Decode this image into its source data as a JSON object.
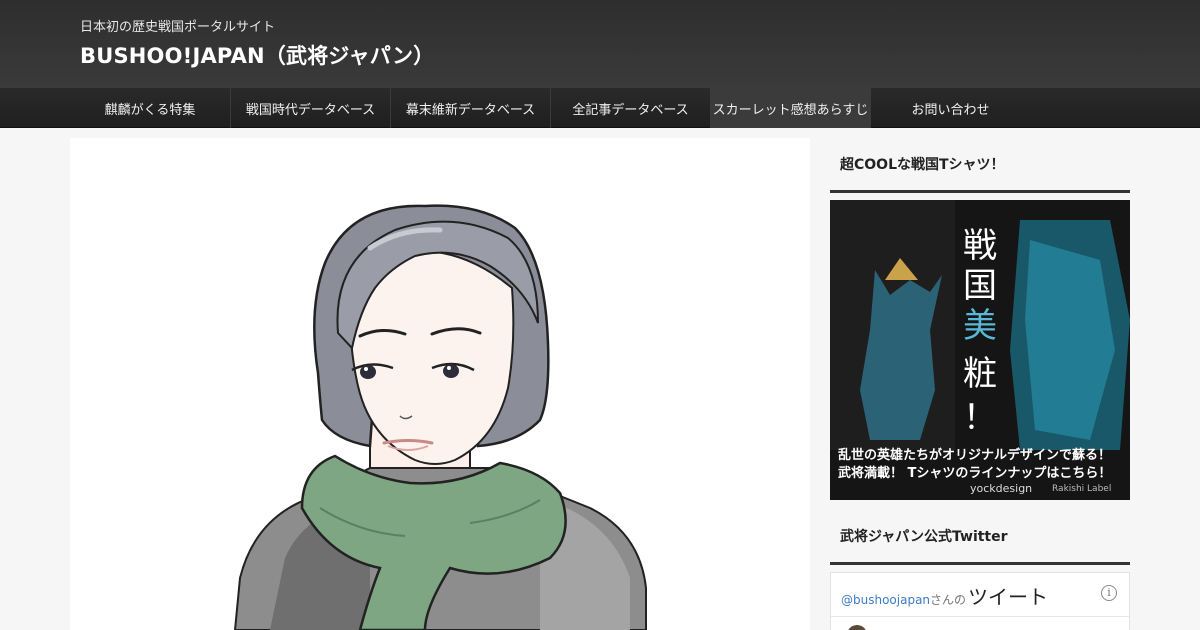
{
  "header": {
    "tagline": "日本初の歴史戦国ポータルサイト",
    "title": "BUSHOO!JAPAN（武将ジャパン）"
  },
  "nav": {
    "items": [
      "麒麟がくる特集",
      "戦国時代データベース",
      "幕末維新データベース",
      "全記事データベース",
      "スカーレット感想あらすじ",
      "お問い合わせ"
    ]
  },
  "sidebar": {
    "tshirt_widget": {
      "title": "超COOLな戦国Tシャツ！",
      "banner_kanji": [
        "戦",
        "国",
        "美",
        "粧",
        "！"
      ],
      "promo_line1": "乱世の英雄たちがオリジナルデザインで蘇る！",
      "promo_line2": "武将満載！ Tシャツのラインナップはこちら！",
      "brand": "yockdesign",
      "brand_sub": "Rakishi Label"
    },
    "twitter_widget": {
      "title": "武将ジャパン公式Twitter",
      "handle": "@bushoojapan",
      "suffix": "さんの",
      "tweet_label": "ツイート",
      "info_icon": "i"
    }
  },
  "colors": {
    "header_bg": "#333333",
    "nav_bg": "#222222",
    "accent_text": "#ffffff",
    "twitter_link": "#3b7cc4"
  }
}
